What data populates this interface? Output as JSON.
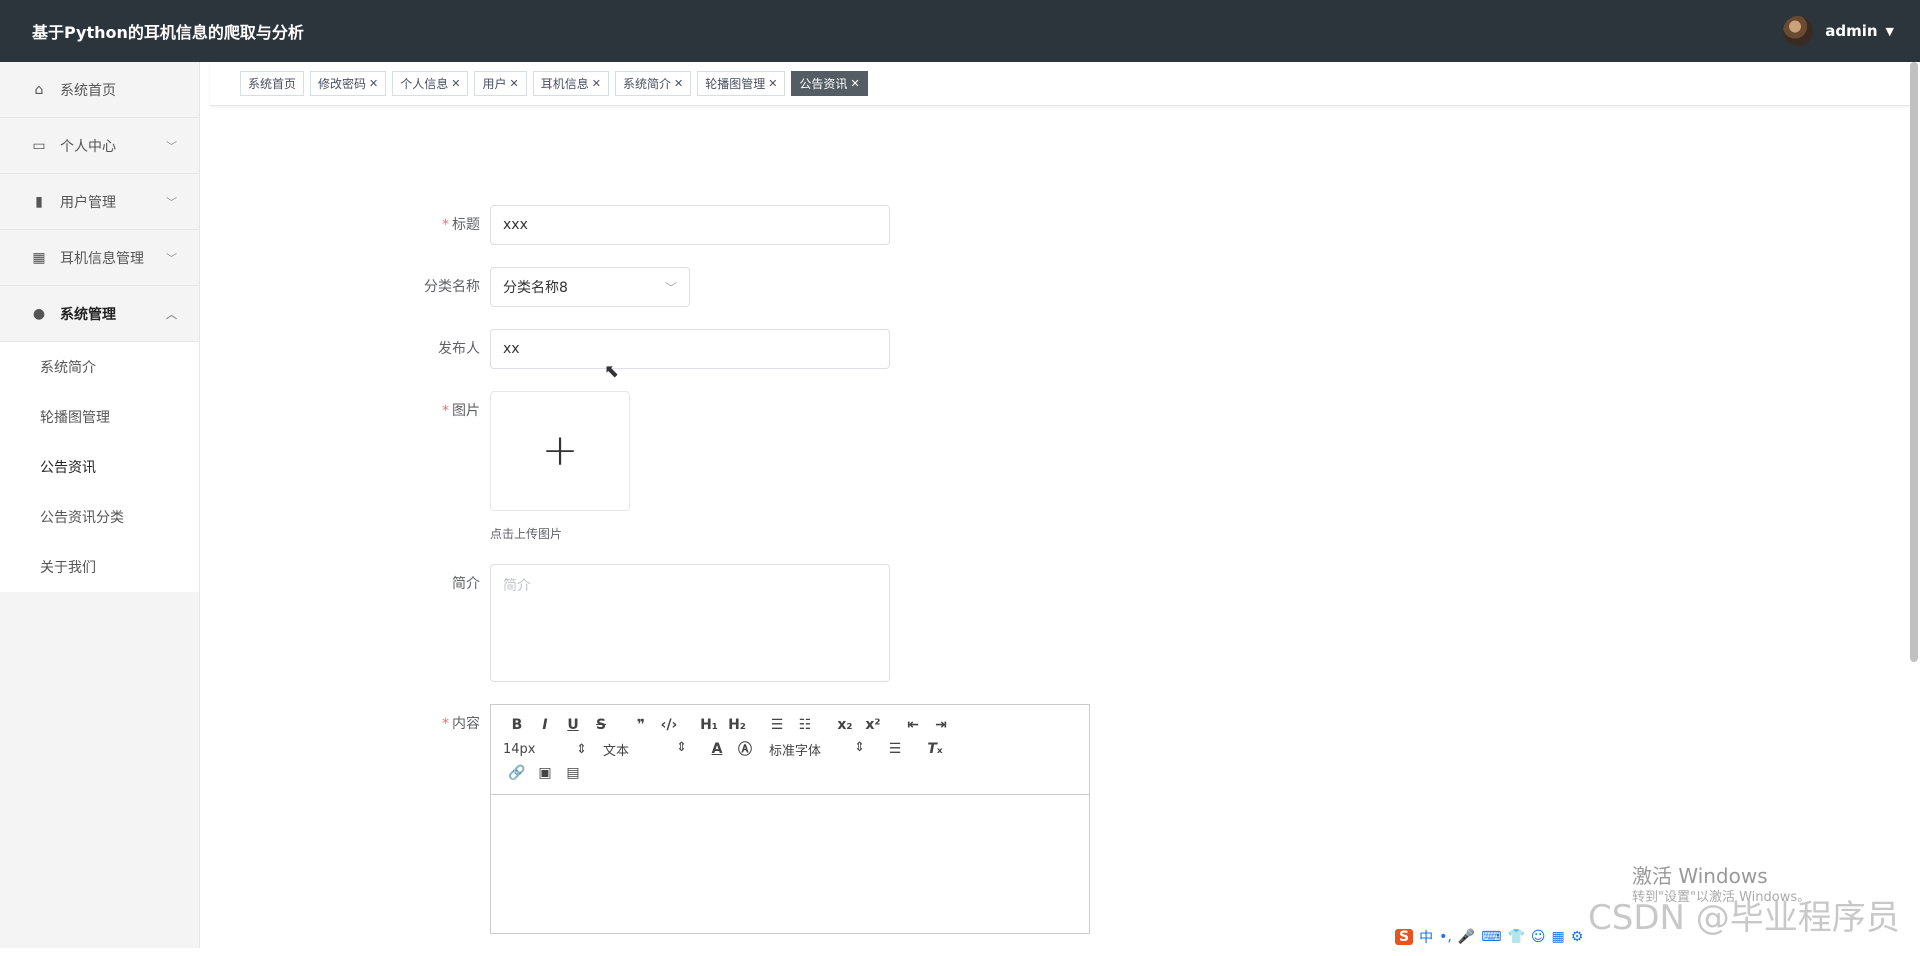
{
  "header": {
    "app_title": "基于Python的耳机信息的爬取与分析",
    "username": "admin"
  },
  "sidebar": {
    "items": [
      {
        "label": "系统首页",
        "icon": "home-icon"
      },
      {
        "label": "个人中心",
        "icon": "wallet-icon"
      },
      {
        "label": "用户管理",
        "icon": "chart-icon"
      },
      {
        "label": "耳机信息管理",
        "icon": "grid-icon"
      },
      {
        "label": "系统管理",
        "icon": "user-icon"
      }
    ],
    "submenu": [
      "系统简介",
      "轮播图管理",
      "公告资讯",
      "公告资讯分类",
      "关于我们"
    ]
  },
  "tabs": [
    "系统首页",
    "修改密码",
    "个人信息",
    "用户",
    "耳机信息",
    "系统简介",
    "轮播图管理",
    "公告资讯"
  ],
  "form": {
    "title_label": "标题",
    "title_value": "xxx",
    "category_label": "分类名称",
    "category_value": "分类名称8",
    "publisher_label": "发布人",
    "publisher_value": "xx",
    "image_label": "图片",
    "upload_hint": "点击上传图片",
    "intro_label": "简介",
    "intro_placeholder": "简介",
    "content_label": "内容",
    "editor": {
      "font_size": "14px",
      "paragraph": "文本",
      "font_family": "标准字体"
    }
  },
  "overlay": {
    "activate_title": "激活 Windows",
    "activate_sub": "转到\"设置\"以激活 Windows。",
    "csdn": "CSDN @毕业程序员"
  },
  "ime": {
    "brand": "S",
    "lang": "中"
  }
}
